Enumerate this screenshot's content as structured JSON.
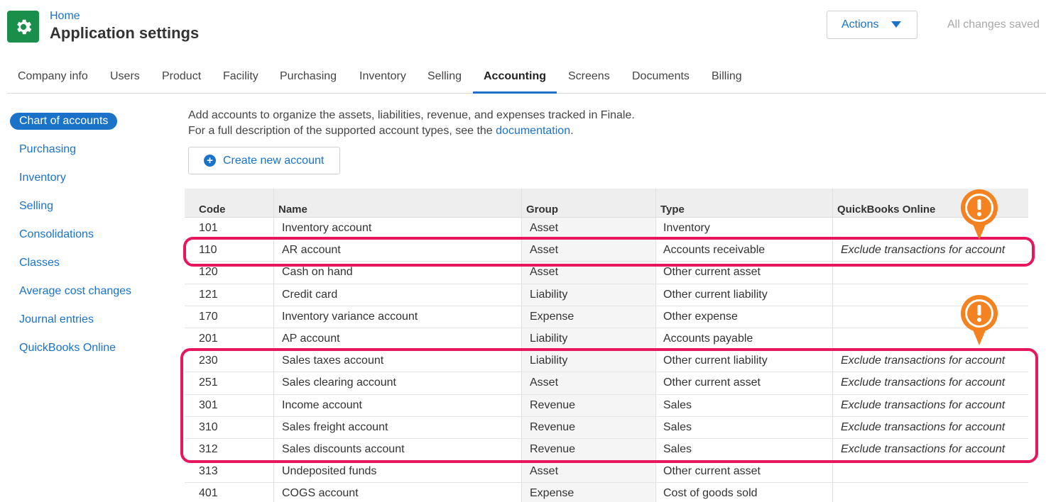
{
  "header": {
    "breadcrumb": "Home",
    "title": "Application settings",
    "actions_label": "Actions",
    "status": "All changes saved"
  },
  "tabs": [
    {
      "label": "Company info"
    },
    {
      "label": "Users"
    },
    {
      "label": "Product"
    },
    {
      "label": "Facility"
    },
    {
      "label": "Purchasing"
    },
    {
      "label": "Inventory"
    },
    {
      "label": "Selling"
    },
    {
      "label": "Accounting",
      "active": true
    },
    {
      "label": "Screens"
    },
    {
      "label": "Documents"
    },
    {
      "label": "Billing"
    }
  ],
  "sidebar": {
    "items": [
      {
        "label": "Chart of accounts",
        "active": true
      },
      {
        "label": "Purchasing"
      },
      {
        "label": "Inventory"
      },
      {
        "label": "Selling"
      },
      {
        "label": "Consolidations"
      },
      {
        "label": "Classes"
      },
      {
        "label": "Average cost changes"
      },
      {
        "label": "Journal entries"
      },
      {
        "label": "QuickBooks Online"
      }
    ]
  },
  "intro": {
    "line1": "Add accounts to organize the assets, liabilities, revenue, and expenses tracked in Finale.",
    "line2_prefix": "For a full description of the supported account types, see the ",
    "link": "documentation",
    "line2_suffix": "."
  },
  "create_button": "Create new account",
  "table": {
    "columns": [
      "Code",
      "Name",
      "Group",
      "Type",
      "QuickBooks Online"
    ],
    "rows": [
      [
        "101",
        "Inventory account",
        "Asset",
        "Inventory",
        ""
      ],
      [
        "110",
        "AR account",
        "Asset",
        "Accounts receivable",
        "Exclude transactions for account"
      ],
      [
        "120",
        "Cash on hand",
        "Asset",
        "Other current asset",
        ""
      ],
      [
        "121",
        "Credit card",
        "Liability",
        "Other current liability",
        ""
      ],
      [
        "170",
        "Inventory variance account",
        "Expense",
        "Other expense",
        ""
      ],
      [
        "201",
        "AP account",
        "Liability",
        "Accounts payable",
        ""
      ],
      [
        "230",
        "Sales taxes account",
        "Liability",
        "Other current liability",
        "Exclude transactions for account"
      ],
      [
        "251",
        "Sales clearing account",
        "Asset",
        "Other current asset",
        "Exclude transactions for account"
      ],
      [
        "301",
        "Income account",
        "Revenue",
        "Sales",
        "Exclude transactions for account"
      ],
      [
        "310",
        "Sales freight account",
        "Revenue",
        "Sales",
        "Exclude transactions for account"
      ],
      [
        "312",
        "Sales discounts account",
        "Revenue",
        "Sales",
        "Exclude transactions for account"
      ],
      [
        "313",
        "Undeposited funds",
        "Asset",
        "Other current asset",
        ""
      ],
      [
        "401",
        "COGS account",
        "Expense",
        "Cost of goods sold",
        ""
      ]
    ]
  },
  "colors": {
    "accent": "#1a73c8",
    "brand": "#1a8f4b",
    "highlight": "#e8175d",
    "callout": "#f58220"
  },
  "icons": {
    "app": "gear-icon",
    "actions": "caret-down-icon",
    "create": "plus-circle-icon",
    "callout": "exclamation-icon"
  }
}
